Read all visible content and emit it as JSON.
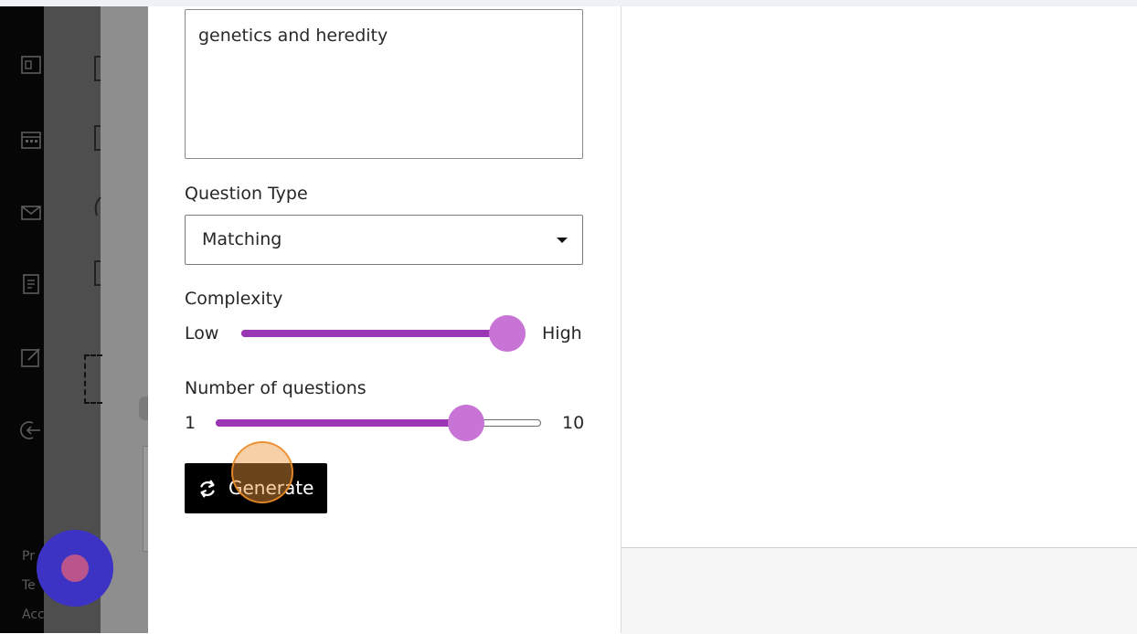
{
  "topic_input": {
    "value": "genetics and heredity"
  },
  "question_type": {
    "label": "Question Type",
    "selected": "Matching"
  },
  "complexity": {
    "label": "Complexity",
    "min_label": "Low",
    "max_label": "High",
    "level_fraction": 0.95
  },
  "num_questions": {
    "label": "Number of questions",
    "min_label": "1",
    "max_label": "10",
    "level_fraction": 0.77
  },
  "generate_button": {
    "label": "Generate",
    "icon": "refresh-icon"
  },
  "left_rail": {
    "icons": [
      "content-icon",
      "calendar-icon",
      "messages-icon",
      "grades-icon",
      "edit-icon",
      "sign-out-icon"
    ],
    "footer_text": [
      "Pr",
      "Te",
      "Acc"
    ]
  },
  "colors": {
    "slider_fill": "#9b36b4",
    "slider_thumb": "#c873d6",
    "button_bg": "#000000",
    "fab": "#3c33c4"
  }
}
